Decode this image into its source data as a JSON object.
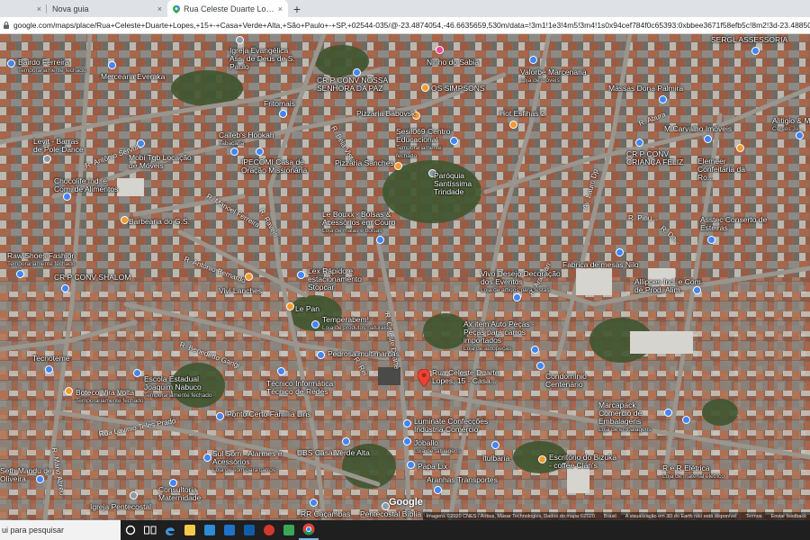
{
  "browser": {
    "tabs": [
      {
        "label": "",
        "active": false
      },
      {
        "label": "Nova guia",
        "active": false
      },
      {
        "label": "Rua Celeste Duarte Lopes, 15 - C...",
        "active": true
      }
    ],
    "new_tab_symbol": "+",
    "close_symbol": "×",
    "url": "google.com/maps/place/Rua+Celeste+Duarte+Lopes,+15+-+Casa+Verde+Alta,+São+Paulo+-+SP,+02544-035/@-23.4874054,-46.6635659,530m/data=!3m1!1e3!4m5!3m4!1s0x94cef784f0c65393:0xbbee3671f58efb5c!8m2!3d-23.4885075!4d-46.6633698"
  },
  "map": {
    "mode": "satellite",
    "selected_place": "Rua Celeste Duarte Lopes, 15 - Casa...",
    "pois": [
      {
        "name": "Bairdo Ferreira",
        "sub": "Temporariamente fechado",
        "color": "blue"
      },
      {
        "name": "Igreja Evangélica Ass. de Deus de S. Paulo",
        "sub": "",
        "color": "gray"
      },
      {
        "name": "Ninho do Sabiá",
        "sub": "",
        "color": "pink"
      },
      {
        "name": "SERGL ASSESSORIA",
        "sub": "",
        "color": "blue"
      },
      {
        "name": "Mercearia Everaka",
        "sub": "",
        "color": "blue"
      },
      {
        "name": "CR P CONV NOSSA SENHORA DA PAZ",
        "sub": "",
        "color": "blue"
      },
      {
        "name": "Valorbe Marcenaria",
        "sub": "Loja de móveis",
        "color": "blue"
      },
      {
        "name": "OS SIMPSONS",
        "sub": "",
        "color": "orange"
      },
      {
        "name": "Massas Dona Palmira",
        "sub": "",
        "color": "blue"
      },
      {
        "name": "Fritomais",
        "sub": "",
        "color": "blue"
      },
      {
        "name": "Pizzaria Babovsk",
        "sub": "",
        "color": "orange"
      },
      {
        "name": "Hot Esfihas 2",
        "sub": "",
        "color": "orange"
      },
      {
        "name": "Sesil069 Centro Educacional",
        "sub": "Temporariamente fechado",
        "color": "blue"
      },
      {
        "name": "Calleb's Hookah",
        "sub": "Tabacaria",
        "color": "blue"
      },
      {
        "name": "M Carvalho Imóveis",
        "sub": "",
        "color": "blue"
      },
      {
        "name": "Alitigio & M...",
        "sub": "Cursos Ju...",
        "color": "blue"
      },
      {
        "name": "Levit - Barras de Pole Dance",
        "sub": "",
        "color": "gray"
      },
      {
        "name": "Mobi Tgb Locação de Móveis",
        "sub": "",
        "color": "blue"
      },
      {
        "name": "IPECOMI Casa de Oração Missionária",
        "sub": "",
        "color": "blue"
      },
      {
        "name": "CR P CONV CRIANÇA FELIZ",
        "sub": "",
        "color": "blue"
      },
      {
        "name": "Elemeer Confeitaria da Ro...",
        "sub": "",
        "color": "orange"
      },
      {
        "name": "Pizzaria Sanches",
        "sub": "",
        "color": "orange"
      },
      {
        "name": "Paróquia Santíssima Trindade",
        "sub": "",
        "color": "gray"
      },
      {
        "name": "Chocolife Ind. e Com. de Alimentos",
        "sub": "",
        "color": "blue"
      },
      {
        "name": "Barbearia do G.S.",
        "sub": "",
        "color": "orange"
      },
      {
        "name": "Le Bouxx - Bolsas & Acessórios em Couro",
        "sub": "Loja de malas e bolsas",
        "color": "blue"
      },
      {
        "name": "Asstec Conserto de Esteiras",
        "sub": "",
        "color": "blue"
      },
      {
        "name": "Raw Shoes Fashion",
        "sub": "Temporariamente fechado",
        "color": "blue"
      },
      {
        "name": "CR P CONV SHALOM",
        "sub": "",
        "color": "blue"
      },
      {
        "name": "Vivi Lanches",
        "sub": "",
        "color": "orange"
      },
      {
        "name": "Lex Rápido e estacionamento Stopcar",
        "sub": "",
        "color": "blue"
      },
      {
        "name": "Vivo Desejo Decoração dos Eventos",
        "sub": "Loja de artigos para festas",
        "color": "blue"
      },
      {
        "name": "Fabrica de mesas Nilo",
        "sub": "",
        "color": "blue"
      },
      {
        "name": "Allippes Ind. e Com. de Prod. Alim.",
        "sub": "",
        "color": "blue"
      },
      {
        "name": "Le Pan",
        "sub": "",
        "color": "orange"
      },
      {
        "name": "Temperabem!",
        "sub": "Loja de produtos naturais",
        "color": "blue"
      },
      {
        "name": "Ax item Auto Peças - Peças para carros importados",
        "sub": "Loja de autopeças",
        "color": "blue"
      },
      {
        "name": "Pedrosa multimarcas",
        "sub": "",
        "color": "blue"
      },
      {
        "name": "Tecnoteme",
        "sub": "",
        "color": "blue"
      },
      {
        "name": "Escola Estadual Joaquim Nabuco",
        "sub": "Temporariamente fechado",
        "color": "blue"
      },
      {
        "name": "Técnico Informática Técnico de Redes",
        "sub": "",
        "color": "blue"
      },
      {
        "name": "Condomínio Centenário",
        "sub": "",
        "color": "blue"
      },
      {
        "name": "Boteco Vira Volta",
        "sub": "Temporariamente fechado",
        "color": "orange"
      },
      {
        "name": "Ponto Certo Família Lins",
        "sub": "",
        "color": "blue"
      },
      {
        "name": "Marcapack Comercio de Embalagens",
        "sub": "Loja de embalagens",
        "color": "blue"
      },
      {
        "name": "Luminate Confecções Indústria Comércio",
        "sub": "",
        "color": "blue"
      },
      {
        "name": "Joballo",
        "sub": "Loja de tatuagens",
        "color": "blue"
      },
      {
        "name": "Sul Som - Alarmes e Acessórios",
        "sub": "Loja de som para carros",
        "color": "blue"
      },
      {
        "name": "UBS Casa Verde Alta",
        "sub": "",
        "color": "blue"
      },
      {
        "name": "Itulbaria",
        "sub": "",
        "color": "blue"
      },
      {
        "name": "Escritório do Bizuka - coffee Clan's",
        "sub": "",
        "color": "orange"
      },
      {
        "name": "R e R Elétrica",
        "sub": "Loja de material elétrico",
        "color": "blue"
      },
      {
        "name": "Papa Lix",
        "sub": "",
        "color": "blue"
      },
      {
        "name": "Seth Mandu de Oliveira",
        "sub": "",
        "color": "blue"
      },
      {
        "name": "Consultoria Maternidade",
        "sub": "",
        "color": "blue"
      },
      {
        "name": "Aranhas Transportes",
        "sub": "",
        "color": "blue"
      },
      {
        "name": "Igreja Pentecostal",
        "sub": "",
        "color": "gray"
      },
      {
        "name": "RR Caçambas",
        "sub": "",
        "color": "blue"
      },
      {
        "name": "Pentecostal Bíblia de...",
        "sub": "",
        "color": "gray"
      }
    ],
    "streets": [
      {
        "name": "R. Antônio Sérvulo",
        "angle": -20
      },
      {
        "name": "R. Manoel Ferreira",
        "angle": 0
      },
      {
        "name": "R. Raveis",
        "angle": 60
      },
      {
        "name": "R. Bela Vista",
        "angle": 60
      },
      {
        "name": "R. Antônio Bernardo",
        "angle": 20
      },
      {
        "name": "R. Benedetto Gangi",
        "angle": 20
      },
      {
        "name": "R. Rei",
        "angle": 60
      },
      {
        "name": "Rua Lavinio Teles Prado",
        "angle": -10
      },
      {
        "name": "R. Abura",
        "angle": -20
      },
      {
        "name": "R. Pinu...",
        "angle": 0
      },
      {
        "name": "R. Do...",
        "angle": 40
      },
      {
        "name": "R. Araguari",
        "angle": -60
      },
      {
        "name": "Av. Lauro Dp",
        "angle": -75
      },
      {
        "name": "R. Celeste Duarte",
        "angle": 80
      },
      {
        "name": "R. Mário Abreu",
        "angle": 80
      }
    ],
    "google_logo": "Google",
    "attribution": [
      "Imagens ©2020 CNES / Airbus, Maxar Technologies, Dados do mapa ©2020",
      "Brasil",
      "A visualização em 3D do Earth não está disponível",
      "Termos",
      "Enviar feedback"
    ]
  },
  "taskbar": {
    "search_placeholder": "ui para pesquisar",
    "apps": [
      "cortana",
      "task-view",
      "edge",
      "file-explorer",
      "store",
      "mail",
      "outlook",
      "app-red",
      "app-green",
      "chrome"
    ]
  }
}
